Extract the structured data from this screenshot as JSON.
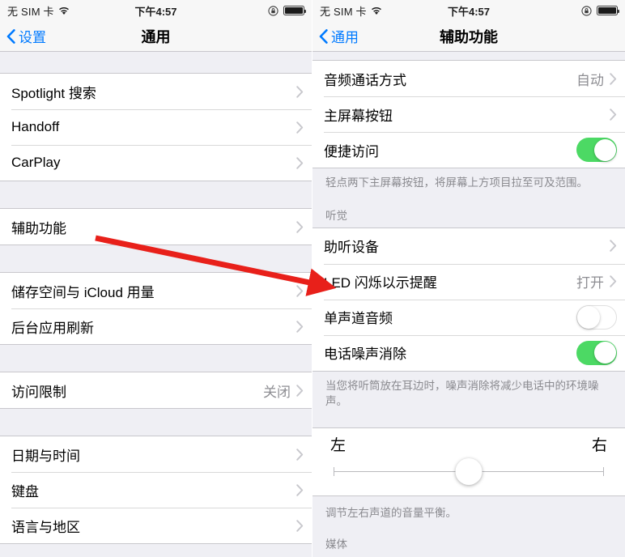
{
  "statusbar": {
    "carrier": "无 SIM 卡",
    "time": "下午4:57",
    "wifi_icon": "wifi-icon",
    "rotation_lock_icon": "rotation-lock-icon",
    "battery_icon": "battery-full-icon"
  },
  "left_screen": {
    "nav": {
      "back_label": "设置",
      "title": "通用",
      "back_icon": "chevron-left-icon"
    },
    "sections": [
      {
        "rows": [
          {
            "label": "Spotlight 搜索",
            "value": "",
            "accessory": "chevron"
          },
          {
            "label": "Handoff",
            "value": "",
            "accessory": "chevron"
          },
          {
            "label": "CarPlay",
            "value": "",
            "accessory": "chevron"
          }
        ]
      },
      {
        "rows": [
          {
            "label": "辅助功能",
            "value": "",
            "accessory": "chevron"
          }
        ]
      },
      {
        "rows": [
          {
            "label": "储存空间与 iCloud 用量",
            "value": "",
            "accessory": "chevron"
          },
          {
            "label": "后台应用刷新",
            "value": "",
            "accessory": "chevron"
          }
        ]
      },
      {
        "rows": [
          {
            "label": "访问限制",
            "value": "关闭",
            "accessory": "chevron"
          }
        ]
      },
      {
        "rows": [
          {
            "label": "日期与时间",
            "value": "",
            "accessory": "chevron"
          },
          {
            "label": "键盘",
            "value": "",
            "accessory": "chevron"
          },
          {
            "label": "语言与地区",
            "value": "",
            "accessory": "chevron"
          }
        ]
      }
    ]
  },
  "right_screen": {
    "nav": {
      "back_label": "通用",
      "title": "辅助功能",
      "back_icon": "chevron-left-icon"
    },
    "rows_top": [
      {
        "label": "音频通话方式",
        "value": "自动",
        "accessory": "chevron"
      },
      {
        "label": "主屏幕按钮",
        "value": "",
        "accessory": "chevron"
      },
      {
        "label": "便捷访问",
        "value": "",
        "accessory": "toggle",
        "toggle_state": "on"
      }
    ],
    "footer_reachability": "轻点两下主屏幕按钮，将屏幕上方项目拉至可及范围。",
    "section_hearing_header": "听觉",
    "rows_hearing": [
      {
        "label": "助听设备",
        "value": "",
        "accessory": "chevron"
      },
      {
        "label": "LED 闪烁以示提醒",
        "value": "打开",
        "accessory": "chevron"
      },
      {
        "label": "单声道音频",
        "value": "",
        "accessory": "toggle",
        "toggle_state": "off"
      },
      {
        "label": "电话噪声消除",
        "value": "",
        "accessory": "toggle",
        "toggle_state": "on"
      }
    ],
    "footer_noise": "当您将听筒放在耳边时，噪声消除将减少电话中的环境噪声。",
    "balance": {
      "left_label": "左",
      "right_label": "右",
      "value_percent": 50,
      "footer": "调节左右声道的音量平衡。"
    },
    "section_media_header": "媒体"
  },
  "annotation": {
    "arrow_icon": "red-arrow-annotation",
    "color": "#E8201A"
  },
  "colors": {
    "accent_blue": "#007AFF",
    "toggle_on_green": "#4CD964",
    "secondary_text": "#8e8e93",
    "group_bg": "#EFEFF4"
  }
}
